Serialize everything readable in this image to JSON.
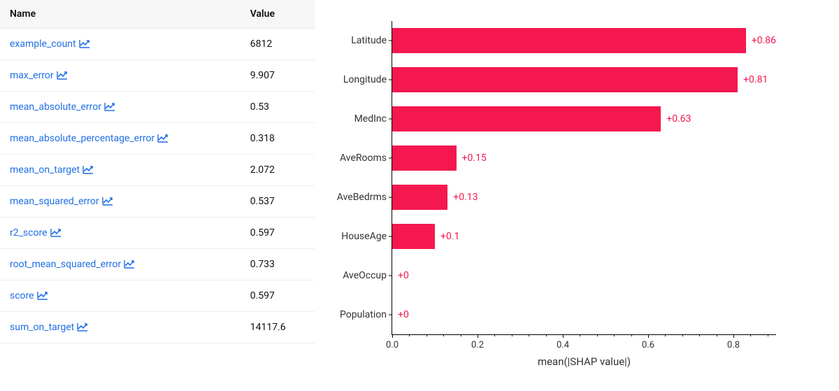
{
  "table": {
    "headers": {
      "name": "Name",
      "value": "Value"
    },
    "rows": [
      {
        "name": "example_count",
        "value": "6812"
      },
      {
        "name": "max_error",
        "value": "9.907"
      },
      {
        "name": "mean_absolute_error",
        "value": "0.53"
      },
      {
        "name": "mean_absolute_percentage_error",
        "value": "0.318"
      },
      {
        "name": "mean_on_target",
        "value": "2.072"
      },
      {
        "name": "mean_squared_error",
        "value": "0.537"
      },
      {
        "name": "r2_score",
        "value": "0.597"
      },
      {
        "name": "root_mean_squared_error",
        "value": "0.733"
      },
      {
        "name": "score",
        "value": "0.597"
      },
      {
        "name": "sum_on_target",
        "value": "14117.6"
      }
    ]
  },
  "chart_data": {
    "type": "bar",
    "orientation": "horizontal",
    "categories": [
      "Latitude",
      "Longitude",
      "MedInc",
      "AveRooms",
      "AveBedrms",
      "HouseAge",
      "AveOccup",
      "Population"
    ],
    "values": [
      0.86,
      0.81,
      0.63,
      0.15,
      0.13,
      0.1,
      0.0,
      0.0
    ],
    "value_labels": [
      "+0.86",
      "+0.81",
      "+0.63",
      "+0.15",
      "+0.13",
      "+0.1",
      "+0",
      "+0"
    ],
    "xlabel": "mean(|SHAP value|)",
    "xlim": [
      0.0,
      0.9
    ],
    "xticks": [
      0.0,
      0.2,
      0.4,
      0.6,
      0.8
    ],
    "xtick_labels": [
      "0.0",
      "0.2",
      "0.4",
      "0.6",
      "0.8"
    ],
    "bar_color": "#f5184f"
  }
}
